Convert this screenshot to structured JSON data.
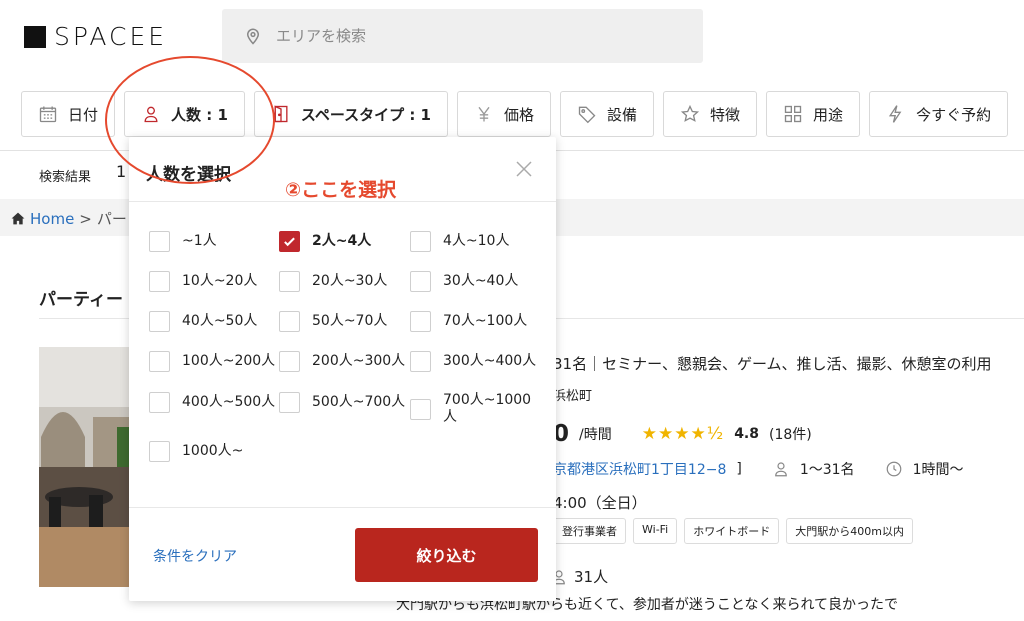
{
  "header": {
    "logo_text": "SPACEE",
    "search_placeholder": "エリアを検索"
  },
  "filters": [
    {
      "label": "日付",
      "icon": "calendar-icon"
    },
    {
      "label": "人数 : 1",
      "icon": "person-icon"
    },
    {
      "label": "スペースタイプ : 1",
      "icon": "door-icon"
    },
    {
      "label": "価格",
      "icon": "yen-icon"
    },
    {
      "label": "設備",
      "icon": "tag-icon"
    },
    {
      "label": "特徴",
      "icon": "star-icon"
    },
    {
      "label": "用途",
      "icon": "grid-icon"
    },
    {
      "label": "今すぐ予約",
      "icon": "lightning-icon"
    }
  ],
  "results": {
    "label": "検索結果",
    "count_partial": "1"
  },
  "breadcrumb": {
    "home": "Home",
    "separator": ">",
    "current_partial": "パー"
  },
  "section_title": "パーティー",
  "listing": {
    "title": "31名｜セミナー、懇親会、ゲーム、推し活、撮影、休憩室の利用",
    "location": "浜松町",
    "price_partial": "0",
    "price_unit": "/時間",
    "stars": "★★★★½",
    "rating": "4.8",
    "reviews": "(18件)",
    "address": "京都港区浜松町1丁目12−8",
    "address_suffix": "]",
    "capacity": "1〜31名",
    "min_time": "1時間〜",
    "hours": "4:00（全日）",
    "tags": [
      "登行事業者",
      "Wi-Fi",
      "ホワイトボード",
      "大門駅から400m以内"
    ],
    "capacity_bottom": "31人",
    "review_text": "大門駅からも浜松町駅からも近くて、参加者が迷うことなく来られて良かったで"
  },
  "dropdown": {
    "title": "人数を選択",
    "options": [
      {
        "label": "~1人",
        "checked": false
      },
      {
        "label": "2人~4人",
        "checked": true
      },
      {
        "label": "4人~10人",
        "checked": false
      },
      {
        "label": "10人~20人",
        "checked": false
      },
      {
        "label": "20人~30人",
        "checked": false
      },
      {
        "label": "30人~40人",
        "checked": false
      },
      {
        "label": "40人~50人",
        "checked": false
      },
      {
        "label": "50人~70人",
        "checked": false
      },
      {
        "label": "70人~100人",
        "checked": false
      },
      {
        "label": "100人~200人",
        "checked": false
      },
      {
        "label": "200人~300人",
        "checked": false
      },
      {
        "label": "300人~400人",
        "checked": false
      },
      {
        "label": "400人~500人",
        "checked": false
      },
      {
        "label": "500人~700人",
        "checked": false
      },
      {
        "label": "700人~1000人",
        "checked": false
      },
      {
        "label": "1000人~",
        "checked": false
      }
    ],
    "clear_label": "条件をクリア",
    "apply_label": "絞り込む"
  },
  "annotation": {
    "text": "②ここを選択",
    "color": "#e5492e"
  },
  "colors": {
    "accent": "#b9261e",
    "link": "#2a6fbd",
    "star": "#f0b400"
  }
}
